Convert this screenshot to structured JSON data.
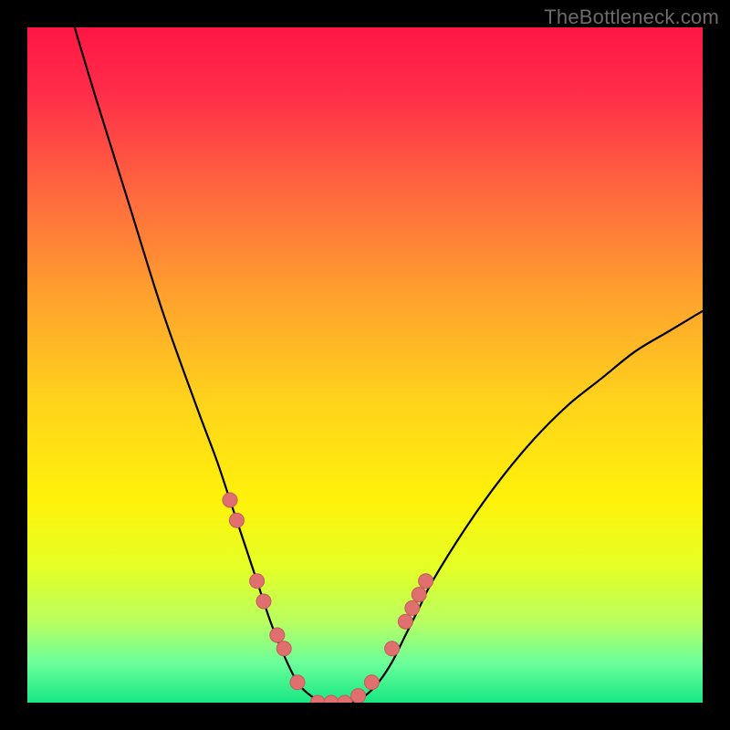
{
  "watermark": "TheBottleneck.com",
  "colors": {
    "gradient_stops": [
      {
        "offset": 0.0,
        "color": "#ff1646"
      },
      {
        "offset": 0.1,
        "color": "#ff2e49"
      },
      {
        "offset": 0.25,
        "color": "#ff6a3e"
      },
      {
        "offset": 0.4,
        "color": "#ffa22e"
      },
      {
        "offset": 0.55,
        "color": "#ffd21c"
      },
      {
        "offset": 0.7,
        "color": "#fff20a"
      },
      {
        "offset": 0.8,
        "color": "#e4ff25"
      },
      {
        "offset": 0.88,
        "color": "#b9ff60"
      },
      {
        "offset": 0.94,
        "color": "#6dff9a"
      },
      {
        "offset": 1.0,
        "color": "#17e884"
      }
    ],
    "curve": "#000000",
    "marker_fill": "#e06f6f",
    "marker_stroke": "#c55a5a"
  },
  "chart_data": {
    "type": "line",
    "title": "",
    "xlabel": "",
    "ylabel": "",
    "xlim": [
      0,
      100
    ],
    "ylim": [
      0,
      100
    ],
    "series": [
      {
        "name": "bottleneck-curve",
        "x": [
          7,
          10,
          15,
          20,
          25,
          28,
          30,
          32,
          34,
          36,
          38,
          40,
          42,
          44,
          46,
          48,
          50,
          52,
          54,
          56,
          58,
          60,
          65,
          70,
          75,
          80,
          85,
          90,
          95,
          100
        ],
        "y": [
          100,
          90,
          74,
          58,
          44,
          36,
          30,
          24,
          18,
          12,
          7,
          3,
          1,
          0,
          0,
          0,
          1,
          3,
          6,
          10,
          14,
          18,
          26,
          33,
          39,
          44,
          48,
          52,
          55,
          58
        ]
      }
    ],
    "markers": {
      "name": "highlight-points",
      "x": [
        30,
        31,
        34,
        35,
        37,
        38,
        40,
        43,
        45,
        47,
        49,
        51,
        54,
        56,
        57,
        58,
        59
      ],
      "y": [
        30,
        27,
        18,
        15,
        10,
        8,
        3,
        0,
        0,
        0,
        1,
        3,
        8,
        12,
        14,
        16,
        18
      ]
    }
  }
}
